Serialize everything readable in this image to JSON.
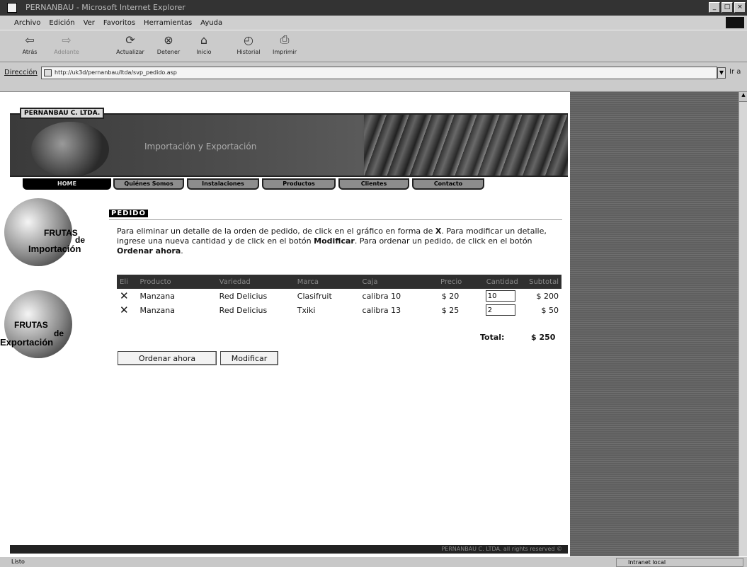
{
  "window": {
    "title": "PERNANBAU - Microsoft Internet Explorer"
  },
  "menu": [
    "Archivo",
    "Edición",
    "Ver",
    "Favoritos",
    "Herramientas",
    "Ayuda"
  ],
  "toolbar": {
    "back": "Atrás",
    "forward": "Adelante",
    "stop": "Detener",
    "refresh": "Actualizar",
    "home": "Inicio",
    "history": "Historial",
    "print": "Imprimir"
  },
  "address": {
    "label": "Dirección",
    "url": "http://uk3d/pernanbau/ltda/svp_pedido.asp",
    "go": "Ir a"
  },
  "site": {
    "brand": "PERNANBAU C. LTDA.",
    "slogan": "Importación y Exportación",
    "nav": [
      "HOME",
      "Quiénes Somos",
      "Instalaciones",
      "Productos",
      "Clientes",
      "Contacto"
    ],
    "promo_import": {
      "line1": "FRUTAS",
      "line2": "de",
      "line3": "Importación"
    },
    "promo_export": {
      "line1": "FRUTAS",
      "line2": "de",
      "line3": "Exportación"
    },
    "footer": "PERNANBAU C. LTDA. all rights reserved ©"
  },
  "pedido": {
    "title": "PEDIDO",
    "instructions_a": "Para eliminar un detalle de la orden de pedido, de click en el gráfico en forma de ",
    "instructions_x": "X",
    "instructions_b": ". Para modificar un detalle, ingrese una nueva cantidad y de click en el botón ",
    "instructions_mod": "Modificar",
    "instructions_c": ". Para ordenar un pedido, de click en el botón ",
    "instructions_ord": "Ordenar ahora",
    "instructions_d": ".",
    "columns": [
      "Eli",
      "Producto",
      "Variedad",
      "Marca",
      "Caja",
      "Precio",
      "Cantidad",
      "Subtotal"
    ],
    "rows": [
      {
        "del": "✕",
        "producto": "Manzana",
        "variedad": "Red Delicius",
        "marca": "Clasifruit",
        "caja": "calibra 10",
        "precio": "$ 20",
        "cantidad": "10",
        "subtotal": "$ 200"
      },
      {
        "del": "✕",
        "producto": "Manzana",
        "variedad": "Red Delicius",
        "marca": "Txiki",
        "caja": "calibra 13",
        "precio": "$ 25",
        "cantidad": "2",
        "subtotal": "$ 50"
      }
    ],
    "total_label": "Total:",
    "total_value": "$ 250",
    "btn_order": "Ordenar ahora",
    "btn_modify": "Modificar"
  },
  "status": {
    "left": "Listo",
    "zone": "Intranet local"
  }
}
